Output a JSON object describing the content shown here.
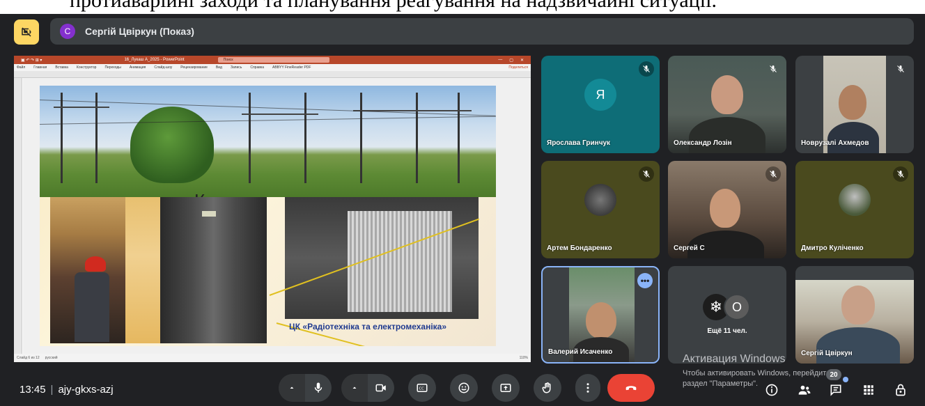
{
  "top_strip_text": "протиаварійні заходи та планування реагування на надзвичайні ситуації.",
  "header": {
    "presenter_avatar_letter": "С",
    "presenter_label": "Сергій Цвіркун (Показ)"
  },
  "presentation": {
    "ppt_title": "16_Лукаш А_2025 - PowerPoint",
    "ppt_search": "Поиск",
    "ppt_menu": [
      "Файл",
      "Главная",
      "Вставка",
      "Конструктор",
      "Переходы",
      "Анимация",
      "Слайд-шоу",
      "Рецензирование",
      "Вид",
      "Запись",
      "Справка",
      "ABBYY FineReader PDF"
    ],
    "ppt_share": "Поделиться",
    "ppt_status_left": "Слайд 6 из 12",
    "ppt_status_lang": "русский",
    "ppt_status_right": "110%",
    "slide_text_fragment": "К",
    "slide_caption": "ЦК «Радіотехніка та електромеханіка»"
  },
  "participants": [
    {
      "name": "Ярослава Гринчук",
      "avatar_letter": "Я",
      "avatar_color": "#0e7c86",
      "tile_color": "#0e6d77",
      "muted": true
    },
    {
      "name": "Олександр Лозін",
      "muted": true
    },
    {
      "name": "Новрузалі Ахмедов",
      "muted": true
    },
    {
      "name": "Артем Бондаренко",
      "muted": true
    },
    {
      "name": "Сергей С",
      "muted": true
    },
    {
      "name": "Дмитро Куліченко",
      "muted": true
    },
    {
      "name": "Валерий Исаченко",
      "muted": false,
      "highlighted": true
    },
    {
      "name": "Ещё 11 чел.",
      "avatar_letter": "О"
    },
    {
      "name": "Сергій Цвіркун"
    }
  ],
  "windows_activation": {
    "line1": "Активация Windows",
    "line2": "Чтобы активировать Windows, перейдите в",
    "line3": "раздел \"Параметры\"."
  },
  "bottom_bar": {
    "time": "13:45",
    "meeting_code": "ajy-gkxs-azj",
    "people_count": "20"
  },
  "icons": {
    "present": "present-to-all-icon",
    "mic": "mic-icon",
    "camera": "camera-icon",
    "captions": "captions-icon",
    "emoji": "emoji-icon",
    "present_now": "present-now-icon",
    "hand": "raise-hand-icon",
    "more": "more-vert-icon",
    "end_call": "end-call-icon",
    "info": "info-icon",
    "people": "people-icon",
    "chat": "chat-icon",
    "activities": "activities-icon",
    "host_controls": "host-controls-icon"
  },
  "colors": {
    "background": "#202124",
    "accent_yellow": "#fdd663",
    "end_call_red": "#ea4335",
    "highlight_blue": "#8ab4f8"
  }
}
